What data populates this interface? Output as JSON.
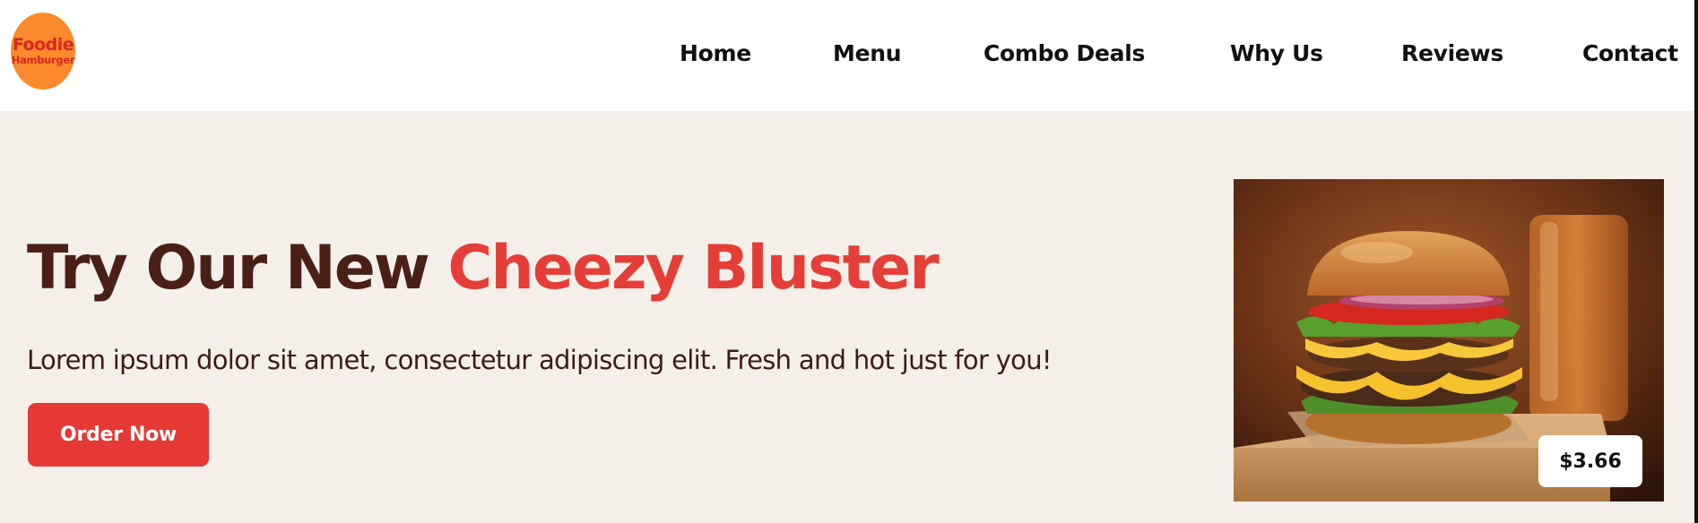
{
  "brand": {
    "line1": "Foodie",
    "line2": "Hamburger"
  },
  "nav": {
    "home": "Home",
    "menu": "Menu",
    "combo": "Combo Deals",
    "why": "Why Us",
    "reviews": "Reviews",
    "contact": "Contact"
  },
  "hero": {
    "title_prefix": "Try Our New",
    "title_accent": "Cheezy Bluster",
    "description": "Lorem ipsum dolor sit amet, consectetur adipiscing elit. Fresh and hot just for you!",
    "cta_label": "Order Now"
  },
  "product": {
    "image_icon": "burger-photo",
    "price": "$3.66"
  },
  "colors": {
    "brand_orange": "#fb8a2d",
    "accent_red": "#e53935",
    "title_brown": "#4a2016",
    "hero_bg": "#f4efe9"
  }
}
